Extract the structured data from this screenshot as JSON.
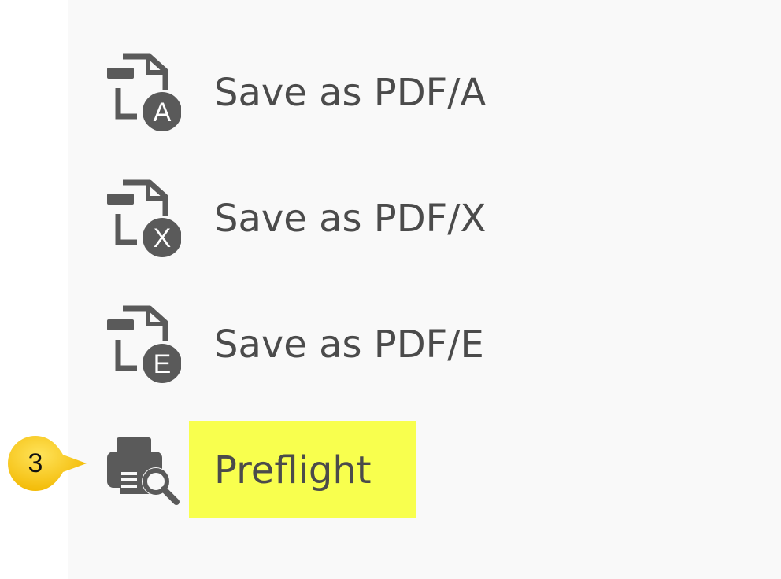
{
  "menu": {
    "items": [
      {
        "label": "Save as PDF/A",
        "badge_letter": "A",
        "icon": "save-as-pdfa-icon"
      },
      {
        "label": "Save as PDF/X",
        "badge_letter": "X",
        "icon": "save-as-pdfx-icon"
      },
      {
        "label": "Save as PDF/E",
        "badge_letter": "E",
        "icon": "save-as-pdfe-icon"
      },
      {
        "label": "Preflight",
        "icon": "preflight-printer-magnifier-icon",
        "highlighted": true
      }
    ]
  },
  "callout": {
    "number": "3",
    "color": "#f5c400"
  },
  "colors": {
    "panel_bg": "#f9f9f9",
    "text": "#4b4b4b",
    "icon": "#5a5a5a",
    "highlight": "#f8ff4e"
  }
}
